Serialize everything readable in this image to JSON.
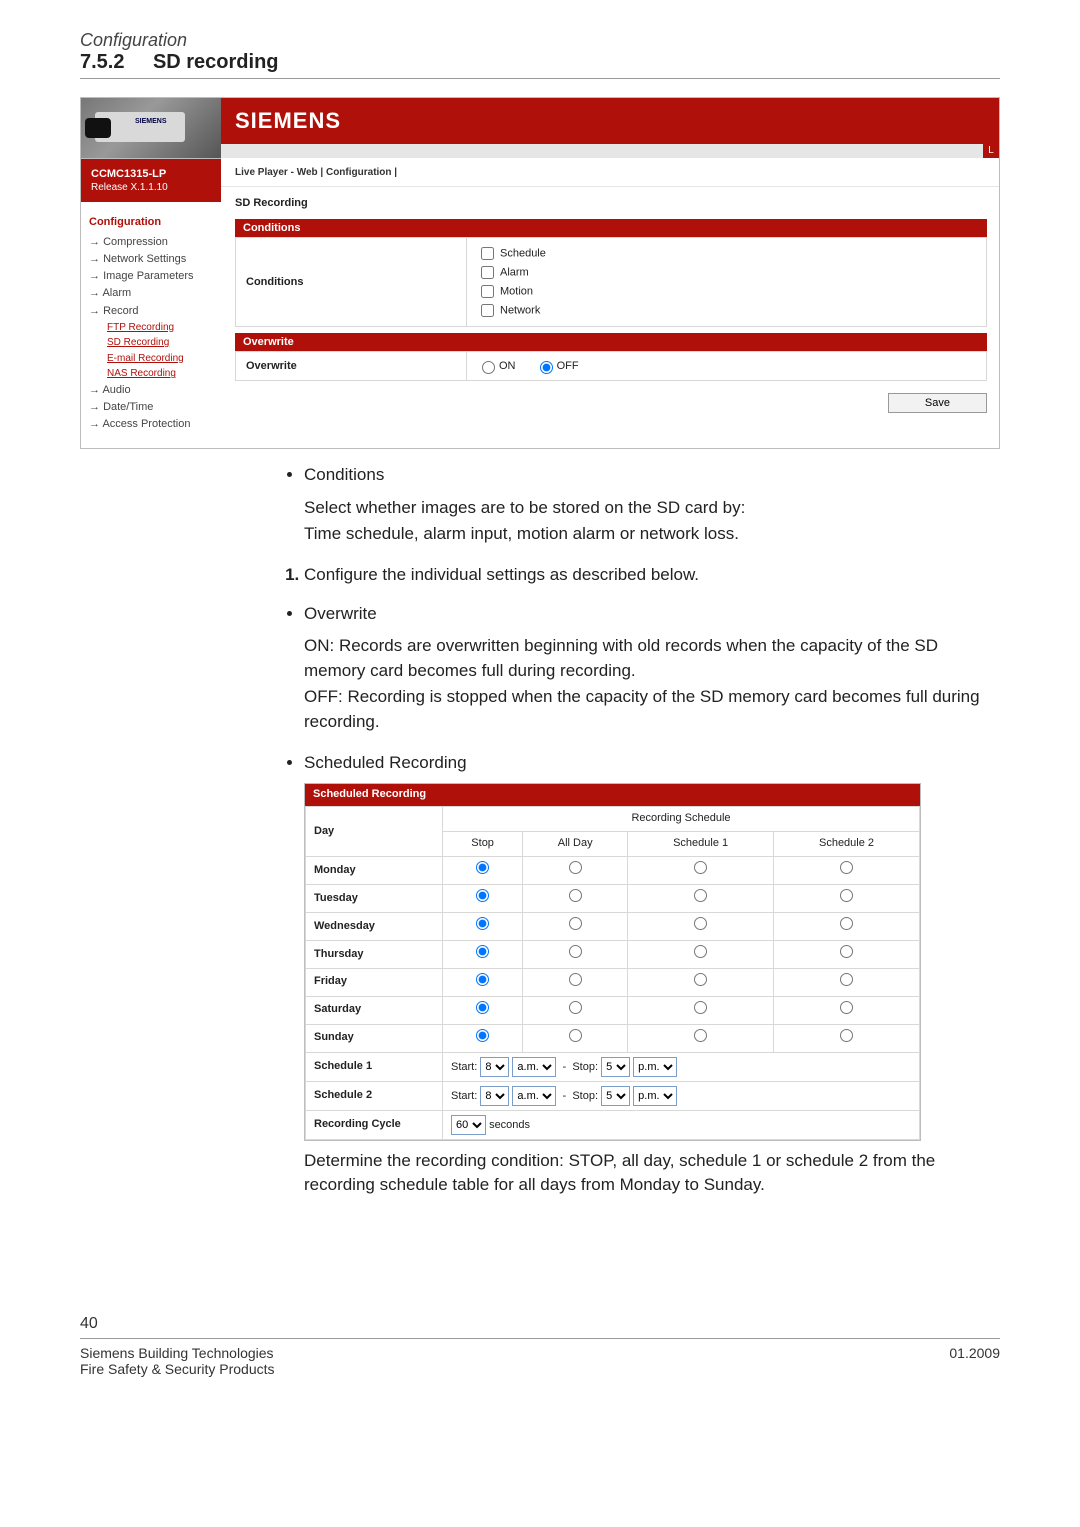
{
  "header": {
    "config": "Configuration",
    "section_number": "7.5.2",
    "section_title": "SD recording"
  },
  "ui": {
    "brand": "SIEMENS",
    "model": "CCMC1315-LP",
    "release": "Release X.1.1.10",
    "crumbs": "Live Player - Web  |  Configuration  |",
    "camera_label": "SIEMENS",
    "nav": {
      "head": "Configuration",
      "items": [
        "Compression",
        "Network Settings",
        "Image Parameters",
        "Alarm",
        "Record"
      ],
      "record_sub": [
        "FTP Recording",
        "SD Recording",
        "E-mail Recording",
        "NAS Recording"
      ],
      "after_record": [
        "Audio",
        "Date/Time",
        "Access Protection"
      ]
    },
    "section_title": "SD Recording",
    "band_conditions": "Conditions",
    "lbl_conditions": "Conditions",
    "chk": {
      "schedule": "Schedule",
      "alarm": "Alarm",
      "motion": "Motion",
      "network": "Network"
    },
    "band_overwrite": "Overwrite",
    "lbl_overwrite": "Overwrite",
    "radio_on": "ON",
    "radio_off": "OFF",
    "save": "Save",
    "ribbon_l": "L"
  },
  "body": {
    "b1_head": "Conditions",
    "b1_p1": "Select whether images are to be stored on the SD card by:",
    "b1_p2": "Time schedule, alarm input, motion alarm or network loss.",
    "step1": "Configure the individual settings as described below.",
    "b2_head": "Overwrite",
    "b2_p1": "ON: Records are overwritten beginning with old records when the capacity of the SD memory card becomes full during recording.",
    "b2_p2": "OFF: Recording is stopped when the capacity of the SD memory card becomes full during recording.",
    "b3_head": "Scheduled Recording",
    "b3_footer": "Determine the recording condition: STOP, all day, schedule 1 or schedule 2 from the recording schedule table for all days from Monday to Sunday."
  },
  "sched": {
    "band": "Scheduled Recording",
    "col_day": "Day",
    "col_group": "Recording Schedule",
    "cols": [
      "Stop",
      "All Day",
      "Schedule 1",
      "Schedule 2"
    ],
    "days": [
      "Monday",
      "Tuesday",
      "Wednesday",
      "Thursday",
      "Friday",
      "Saturday",
      "Sunday"
    ],
    "schedule1_label": "Schedule 1",
    "schedule2_label": "Schedule 2",
    "cycle_label": "Recording Cycle",
    "start": "Start:",
    "stop": "Stop:",
    "am": "a.m.",
    "pm": "p.m.",
    "start_hour": "8",
    "stop_hour": "5",
    "cycle_val": "60",
    "cycle_unit": "seconds",
    "dash": "-"
  },
  "footer": {
    "page": "40",
    "l1": "Siemens Building Technologies",
    "l2": "Fire Safety & Security Products",
    "date": "01.2009"
  },
  "chart_data": {
    "type": "table",
    "title": "Recording Schedule",
    "columns": [
      "Day",
      "Stop",
      "All Day",
      "Schedule 1",
      "Schedule 2"
    ],
    "rows": [
      {
        "Day": "Monday",
        "selected": "Stop"
      },
      {
        "Day": "Tuesday",
        "selected": "Stop"
      },
      {
        "Day": "Wednesday",
        "selected": "Stop"
      },
      {
        "Day": "Thursday",
        "selected": "Stop"
      },
      {
        "Day": "Friday",
        "selected": "Stop"
      },
      {
        "Day": "Saturday",
        "selected": "Stop"
      },
      {
        "Day": "Sunday",
        "selected": "Stop"
      }
    ],
    "schedule1": {
      "start": "8 a.m.",
      "stop": "5 p.m."
    },
    "schedule2": {
      "start": "8 a.m.",
      "stop": "5 p.m."
    },
    "recording_cycle_seconds": 60
  }
}
